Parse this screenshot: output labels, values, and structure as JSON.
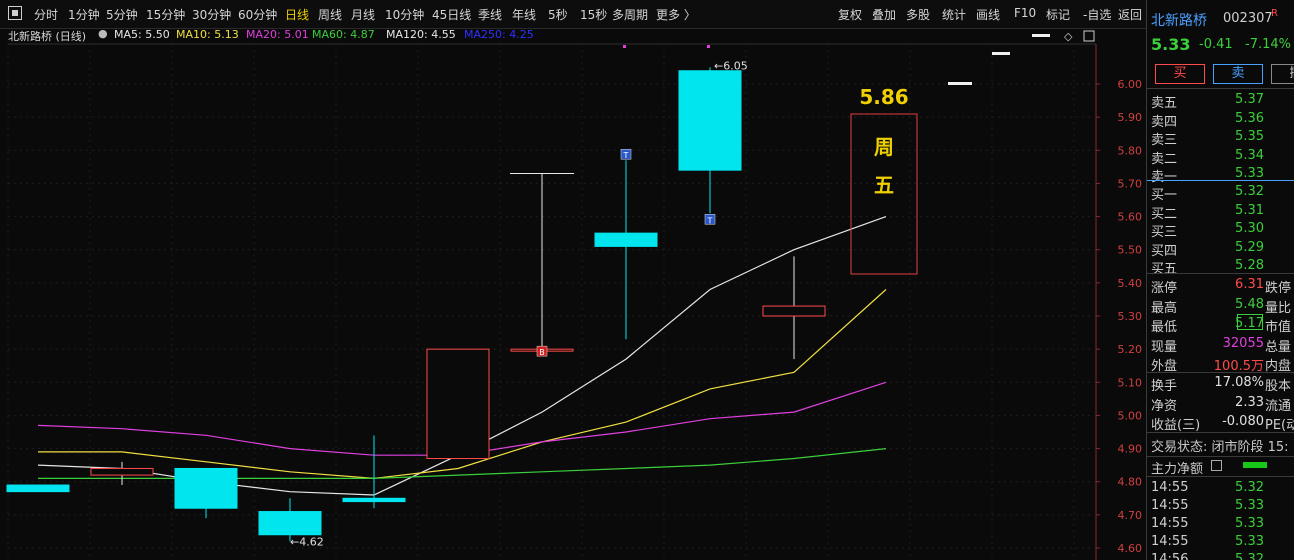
{
  "toolbar": {
    "periods": [
      "分时",
      "1分钟",
      "5分钟",
      "15分钟",
      "30分钟",
      "60分钟",
      "日线",
      "周线",
      "月线",
      "10分钟",
      "45日线",
      "季线",
      "年线",
      "5秒",
      "15秒",
      "多周期",
      "更多 〉"
    ],
    "active_period": "日线",
    "right_items": [
      "复权",
      "叠加",
      "多股",
      "统计",
      "画线",
      "F10",
      "标记",
      "-自选",
      "返回"
    ]
  },
  "chart_header": {
    "name": "北新路桥 (日线)",
    "ma": [
      {
        "label": "MA5: 5.50",
        "color": "#e6e6e6"
      },
      {
        "label": "MA10: 5.13",
        "color": "#f0e040"
      },
      {
        "label": "MA20: 5.01",
        "color": "#e040e0"
      },
      {
        "label": "MA60: 4.87",
        "color": "#3ccf3c"
      },
      {
        "label": "MA120: 4.55",
        "color": "#e6e6e6"
      },
      {
        "label": "MA250: 4.25",
        "color": "#3030ff"
      }
    ]
  },
  "chart_data": {
    "type": "candlestick",
    "y_ticks": [
      "6.00",
      "5.90",
      "5.80",
      "5.70",
      "5.60",
      "5.50",
      "5.40",
      "5.30",
      "5.20",
      "5.10",
      "5.00",
      "4.90",
      "4.80",
      "4.70",
      "4.60"
    ],
    "ylim": [
      4.58,
      6.07
    ],
    "candles": [
      {
        "o": 4.79,
        "c": 4.77,
        "h": 4.79,
        "l": 4.77
      },
      {
        "o": 4.82,
        "c": 4.84,
        "h": 4.86,
        "l": 4.79
      },
      {
        "o": 4.84,
        "c": 4.72,
        "h": 4.84,
        "l": 4.69
      },
      {
        "o": 4.71,
        "c": 4.64,
        "h": 4.75,
        "l": 4.62
      },
      {
        "o": 4.75,
        "c": 4.74,
        "h": 4.94,
        "l": 4.72
      },
      {
        "o": 4.87,
        "c": 5.2,
        "h": 5.2,
        "l": 4.87
      },
      {
        "o": 5.2,
        "c": 5.2,
        "h": 5.73,
        "l": 5.2
      },
      {
        "o": 5.55,
        "c": 5.51,
        "h": 5.77,
        "l": 5.23
      },
      {
        "o": 6.04,
        "c": 5.74,
        "h": 6.05,
        "l": 5.61
      },
      {
        "o": 5.3,
        "c": 5.33,
        "h": 5.48,
        "l": 5.17
      }
    ],
    "ma_lines": [
      {
        "name": "MA5",
        "color": "#e6e6e6",
        "values": [
          4.85,
          4.84,
          4.8,
          4.77,
          4.76,
          4.88,
          5.01,
          5.17,
          5.38,
          5.5,
          5.6
        ]
      },
      {
        "name": "MA10",
        "color": "#f0e040",
        "values": [
          4.89,
          4.89,
          4.86,
          4.83,
          4.81,
          4.84,
          4.92,
          4.98,
          5.08,
          5.13,
          5.38
        ]
      },
      {
        "name": "MA20",
        "color": "#e040e0",
        "values": [
          4.97,
          4.96,
          4.94,
          4.9,
          4.88,
          4.88,
          4.92,
          4.95,
          4.99,
          5.01,
          5.1
        ]
      },
      {
        "name": "MA60",
        "color": "#3ccf3c",
        "values": [
          4.81,
          4.81,
          4.81,
          4.81,
          4.81,
          4.82,
          4.83,
          4.84,
          4.85,
          4.87,
          4.9
        ]
      }
    ],
    "annotations": {
      "high_label": "6.05",
      "low_label": "4.62",
      "price_note": "5.86",
      "box_text": [
        "周",
        "五"
      ],
      "markers": [
        "B",
        "T",
        "T"
      ]
    }
  },
  "side_panel": {
    "stock_name": "北新路桥",
    "code": "002307",
    "flag": "R",
    "price": "5.33",
    "change": "-0.41",
    "change_pct": "-7.14%",
    "buy_label": "买",
    "sell_label": "卖",
    "other_label": "撤",
    "asks": [
      {
        "label": "卖五",
        "price": "5.37"
      },
      {
        "label": "卖四",
        "price": "5.36"
      },
      {
        "label": "卖三",
        "price": "5.35"
      },
      {
        "label": "卖二",
        "price": "5.34"
      },
      {
        "label": "卖一",
        "price": "5.33"
      }
    ],
    "bids": [
      {
        "label": "买一",
        "price": "5.32"
      },
      {
        "label": "买二",
        "price": "5.31"
      },
      {
        "label": "买三",
        "price": "5.30"
      },
      {
        "label": "买四",
        "price": "5.29"
      },
      {
        "label": "买五",
        "price": "5.28"
      }
    ],
    "stats1": [
      {
        "label": "涨停",
        "value": "6.31",
        "cls": "red",
        "right": "跌停"
      },
      {
        "label": "最高",
        "value": "5.48",
        "cls": "green",
        "right": "量比"
      },
      {
        "label": "最低",
        "value": "5.17",
        "cls": "green",
        "right": "市值"
      },
      {
        "label": "现量",
        "value": "32055",
        "cls": "mag",
        "right": "总量"
      },
      {
        "label": "外盘",
        "value": "100.5万",
        "cls": "red",
        "right": "内盘"
      }
    ],
    "stats2": [
      {
        "label": "换手",
        "value": "17.08%",
        "cls": "white",
        "right": "股本"
      },
      {
        "label": "净资",
        "value": "2.33",
        "cls": "white",
        "right": "流通"
      },
      {
        "label": "收益(三)",
        "value": "-0.080",
        "cls": "white",
        "right": "PE(动"
      }
    ],
    "trade_status": "交易状态: 闭市阶段 15:",
    "net_flow_label": "主力净额",
    "ticks": [
      {
        "time": "14:55",
        "price": "5.32"
      },
      {
        "time": "14:55",
        "price": "5.33"
      },
      {
        "time": "14:55",
        "price": "5.33"
      },
      {
        "time": "14:55",
        "price": "5.33"
      },
      {
        "time": "14:56",
        "price": "5.32"
      }
    ]
  }
}
